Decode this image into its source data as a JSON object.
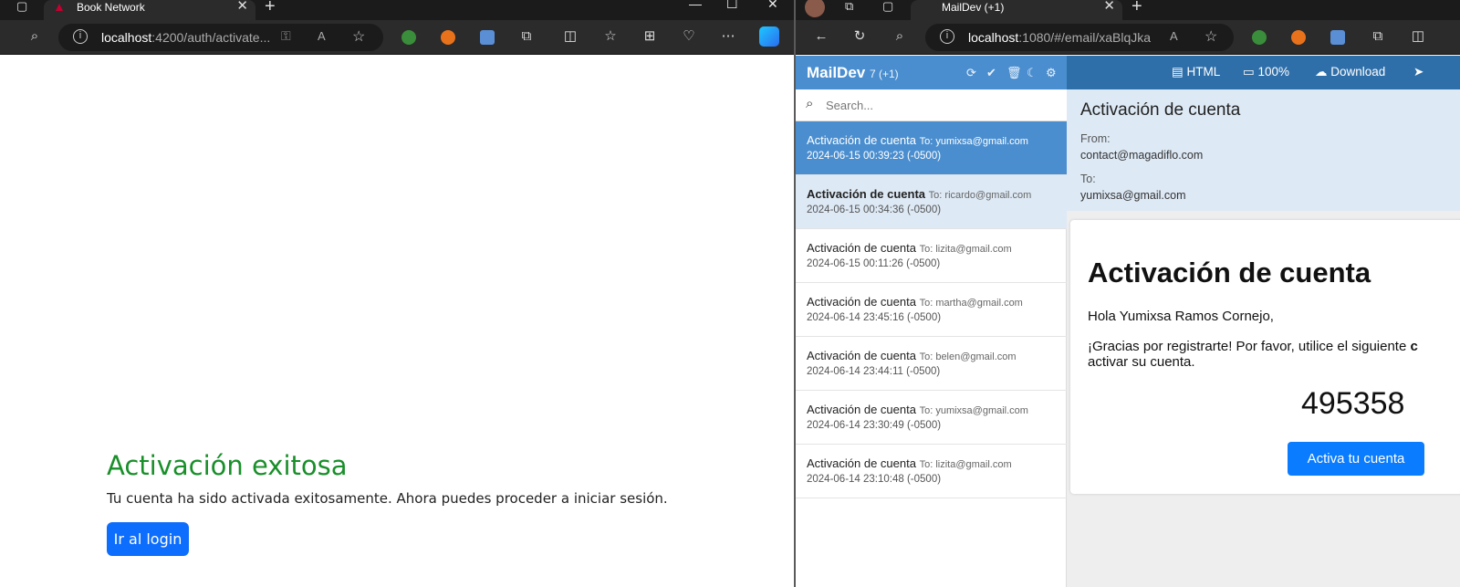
{
  "left_browser": {
    "tab_title": "Book Network",
    "tab_close": "✕",
    "new_tab": "+",
    "url_host": "localhost",
    "url_rest": ":4200/auth/activate...",
    "window_controls": [
      "—",
      "☐",
      "✕"
    ],
    "icons": [
      "back-icon",
      "search-icon",
      "info-icon",
      "key-icon",
      "read-aloud-icon",
      "favorite-icon",
      "extensions-icon",
      "split-screen-icon",
      "favorites-icon",
      "collections-icon",
      "performance-icon",
      "more-icon",
      "copilot-icon"
    ]
  },
  "page": {
    "title": "Activación exitosa",
    "message": "Tu cuenta ha sido activada exitosamente. Ahora puedes proceder a iniciar sesión.",
    "button": "Ir al login",
    "title_color": "#198f2a",
    "button_color": "#0d6efd"
  },
  "right_browser": {
    "tab_title": "MailDev (+1)",
    "tab_close": "✕",
    "new_tab": "+",
    "url_host": "localhost",
    "url_rest": ":1080/#/email/xaBlqJka"
  },
  "maildev": {
    "brand": "MailDev",
    "count": "7 (+1)",
    "search_placeholder": "Search...",
    "view_bar": {
      "html": "HTML",
      "zoom": "100%",
      "download": "Download"
    },
    "emails": [
      {
        "subject": "Activación de cuenta",
        "to": "To: yumixsa@gmail.com",
        "date": "2024-06-15 00:39:23 (-0500)"
      },
      {
        "subject": "Activación de cuenta",
        "to": "To: ricardo@gmail.com",
        "date": "2024-06-15 00:34:36 (-0500)"
      },
      {
        "subject": "Activación de cuenta",
        "to": "To: lizita@gmail.com",
        "date": "2024-06-15 00:11:26 (-0500)"
      },
      {
        "subject": "Activación de cuenta",
        "to": "To: martha@gmail.com",
        "date": "2024-06-14 23:45:16 (-0500)"
      },
      {
        "subject": "Activación de cuenta",
        "to": "To: belen@gmail.com",
        "date": "2024-06-14 23:44:11 (-0500)"
      },
      {
        "subject": "Activación de cuenta",
        "to": "To: yumixsa@gmail.com",
        "date": "2024-06-14 23:30:49 (-0500)"
      },
      {
        "subject": "Activación de cuenta",
        "to": "To: lizita@gmail.com",
        "date": "2024-06-14 23:10:48 (-0500)"
      }
    ],
    "detail": {
      "subject": "Activación de cuenta",
      "from_label": "From:",
      "from": "contact@magadiflo.com",
      "to_label": "To:",
      "to": "yumixsa@gmail.com"
    },
    "email_body": {
      "heading": "Activación de cuenta",
      "greeting": "Hola Yumixsa Ramos Cornejo,",
      "text_part1": "¡Gracias por registrarte! Por favor, utilice el siguiente ",
      "text_bold": "c",
      "text_part2": "activar su cuenta.",
      "code": "495358",
      "button": "Activa tu cuenta"
    },
    "header_color": "#4a8ecf"
  }
}
